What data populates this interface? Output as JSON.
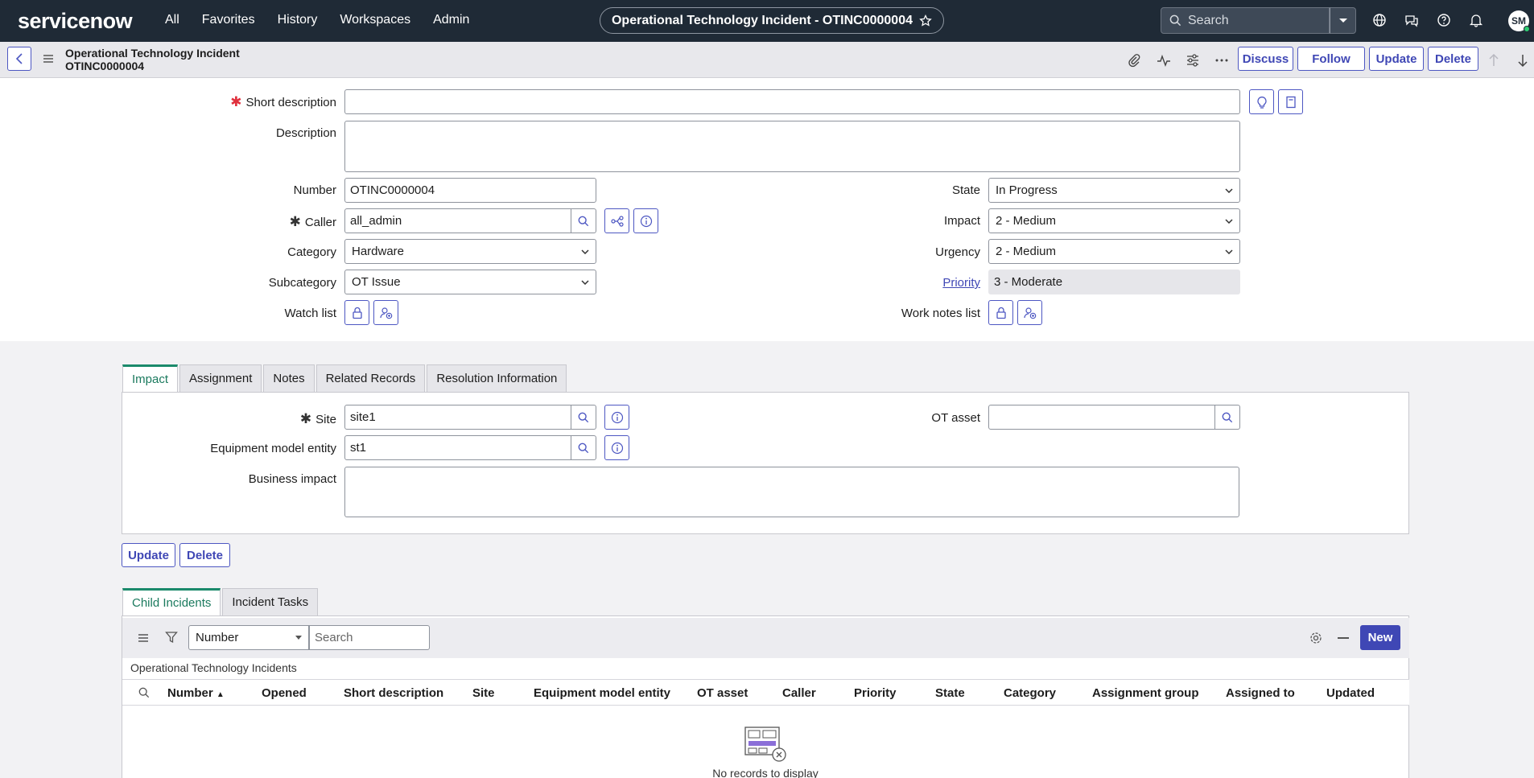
{
  "topnav": {
    "logo": "servicenow",
    "menu": [
      "All",
      "Favorites",
      "History",
      "Workspaces",
      "Admin"
    ],
    "record_title": "Operational Technology Incident - OTINC0000004",
    "search_placeholder": "Search",
    "avatar_initials": "SM"
  },
  "header": {
    "title_line1": "Operational Technology Incident",
    "title_line2": "OTINC0000004",
    "buttons": {
      "discuss": "Discuss",
      "follow": "Follow",
      "update": "Update",
      "delete": "Delete"
    }
  },
  "form": {
    "short_description": {
      "label": "Short description",
      "value": ""
    },
    "description": {
      "label": "Description",
      "value": ""
    },
    "number": {
      "label": "Number",
      "value": "OTINC0000004"
    },
    "caller": {
      "label": "Caller",
      "value": "all_admin"
    },
    "category": {
      "label": "Category",
      "value": "Hardware"
    },
    "subcategory": {
      "label": "Subcategory",
      "value": "OT Issue"
    },
    "watch_list": {
      "label": "Watch list"
    },
    "state": {
      "label": "State",
      "value": "In Progress"
    },
    "impact": {
      "label": "Impact",
      "value": "2 - Medium"
    },
    "urgency": {
      "label": "Urgency",
      "value": "2 - Medium"
    },
    "priority": {
      "label": "Priority",
      "value": "3 - Moderate"
    },
    "work_notes_list": {
      "label": "Work notes list"
    }
  },
  "section_tabs": [
    "Impact",
    "Assignment",
    "Notes",
    "Related Records",
    "Resolution Information"
  ],
  "impact_section": {
    "site": {
      "label": "Site",
      "value": "site1"
    },
    "equipment_model_entity": {
      "label": "Equipment model entity",
      "value": "st1"
    },
    "business_impact": {
      "label": "Business impact",
      "value": ""
    },
    "ot_asset": {
      "label": "OT asset",
      "value": ""
    }
  },
  "bottom_buttons": {
    "update": "Update",
    "delete": "Delete"
  },
  "related_tabs": [
    "Child Incidents",
    "Incident Tasks"
  ],
  "list": {
    "filter_field": "Number",
    "search_placeholder": "Search",
    "new_button": "New",
    "title": "Operational Technology Incidents",
    "columns": [
      "Number",
      "Opened",
      "Short description",
      "Site",
      "Equipment model entity",
      "OT asset",
      "Caller",
      "Priority",
      "State",
      "Category",
      "Assignment group",
      "Assigned to",
      "Updated"
    ],
    "empty_text": "No records to display"
  },
  "colors": {
    "nav_bg": "#1f2a36",
    "accent": "#4d57c2",
    "tab_active": "#1b8a6b",
    "required": "#e0303d"
  }
}
